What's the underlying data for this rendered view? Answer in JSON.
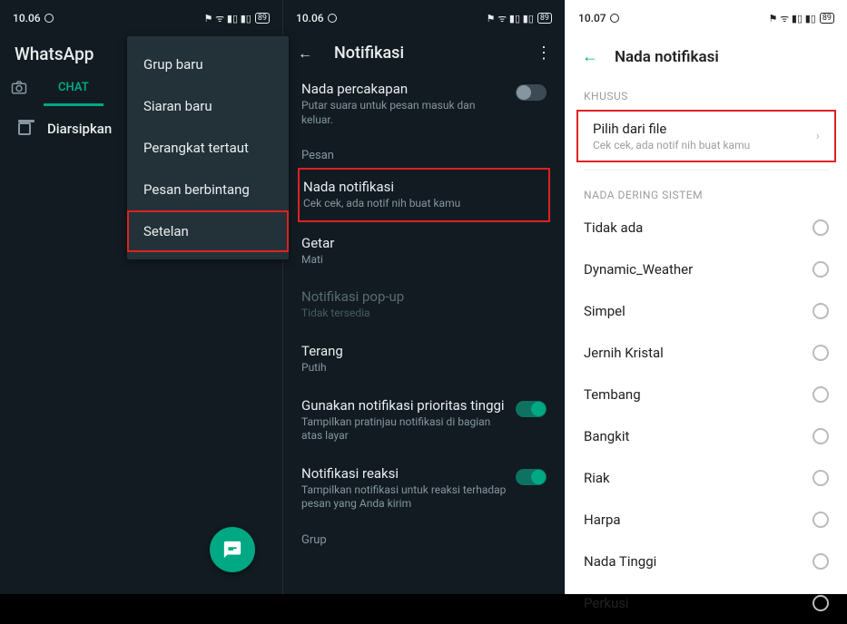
{
  "status": {
    "time": "10.06",
    "time3": "10.07",
    "batt": "89"
  },
  "panel1": {
    "app": "WhatsApp",
    "tab_chat": "CHAT",
    "archived": "Diarsipkan",
    "menu": [
      "Grup baru",
      "Siaran baru",
      "Perangkat tertaut",
      "Pesan berbintang",
      "Setelan"
    ]
  },
  "panel2": {
    "title": "Notifikasi",
    "convo": {
      "label": "Nada percakapan",
      "sub": "Putar suara untuk pesan masuk dan keluar."
    },
    "section_pesan": "Pesan",
    "items": [
      {
        "label": "Nada notifikasi",
        "sub": "Cek cek, ada notif nih buat kamu"
      },
      {
        "label": "Getar",
        "sub": "Mati"
      },
      {
        "label": "Notifikasi pop-up",
        "sub": "Tidak tersedia"
      },
      {
        "label": "Terang",
        "sub": "Putih"
      },
      {
        "label": "Gunakan notifikasi prioritas tinggi",
        "sub": "Tampilkan pratinjau notifikasi di bagian atas layar"
      },
      {
        "label": "Notifikasi reaksi",
        "sub": "Tampilkan notifikasi untuk reaksi terhadap pesan yang Anda kirim"
      }
    ],
    "section_grup": "Grup"
  },
  "panel3": {
    "title": "Nada notifikasi",
    "hdr_khusus": "KHUSUS",
    "file": {
      "label": "Pilih dari file",
      "sub": "Cek cek, ada notif nih buat kamu"
    },
    "hdr_system": "NADA DERING SISTEM",
    "tones": [
      "Tidak ada",
      "Dynamic_Weather",
      "Simpel",
      "Jernih Kristal",
      "Tembang",
      "Bangkit",
      "Riak",
      "Harpa",
      "Nada Tinggi",
      "Perkusi"
    ]
  }
}
